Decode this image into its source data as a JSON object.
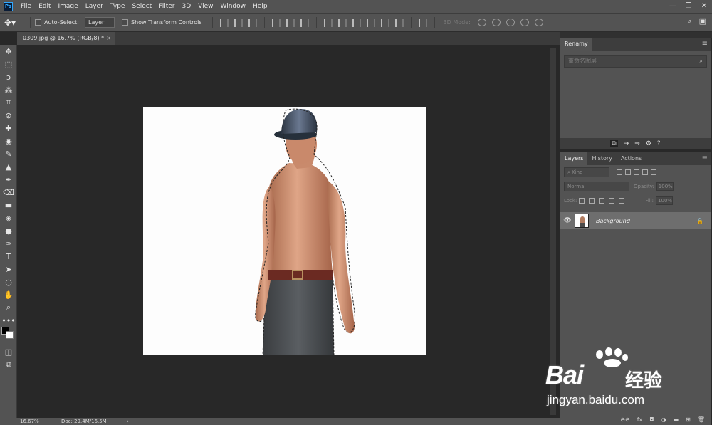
{
  "app": {
    "logo": "Ps"
  },
  "menu": [
    "File",
    "Edit",
    "Image",
    "Layer",
    "Type",
    "Select",
    "Filter",
    "3D",
    "View",
    "Window",
    "Help"
  ],
  "window_controls": {
    "minimize": "—",
    "restore": "❐",
    "close": "✕"
  },
  "options": {
    "move_icon": "✥▾",
    "auto_select_label": "Auto-Select:",
    "auto_select_value": "Layer",
    "transform_label": "Show Transform Controls",
    "mode3d_label": "3D Mode:",
    "search_icon": "⌕",
    "workspace_icon": "▣"
  },
  "tools": [
    "✥",
    "⬚",
    "ↄ",
    "⁂",
    "⌗",
    "⊘",
    "✚",
    "◉",
    "✎",
    "▲",
    "✒",
    "⌫",
    "▬",
    "◈",
    "●",
    "✑",
    "T",
    "➤",
    "○",
    "✋",
    "⌕",
    "•••"
  ],
  "tools_bottom": [
    "◫",
    "⧉"
  ],
  "document": {
    "tab_label": "0309.jpg @ 16.7% (RGB/8) *",
    "close": "×"
  },
  "status": {
    "zoom": "16.67%",
    "doc_info": "Doc: 29.4M/16.5M",
    "arrow": "›"
  },
  "renamy": {
    "tab": "Renamy",
    "placeholder": "重命名图层",
    "search_icon": "⌕",
    "strip": [
      "⧉",
      "→",
      "⇒",
      "⚙",
      "?"
    ]
  },
  "layers_panel": {
    "tabs": [
      "Layers",
      "History",
      "Actions"
    ],
    "menu_icon": "≡",
    "kind_label": "⌕ Kind",
    "blend_mode": "Normal",
    "opacity_label": "Opacity:",
    "opacity_value": "100%",
    "lock_label": "Lock:",
    "fill_label": "Fill:",
    "fill_value": "100%",
    "layers": [
      {
        "name": "Background",
        "visible_icon": "👁",
        "lock_icon": "🔒"
      }
    ],
    "footer": [
      "⊖⊖",
      "fx",
      "◘",
      "◑",
      "▬",
      "⊞",
      "🗑"
    ]
  },
  "watermark": {
    "brand": "Bai",
    "brand_cn": "经验",
    "url": "jingyan.baidu.com"
  }
}
